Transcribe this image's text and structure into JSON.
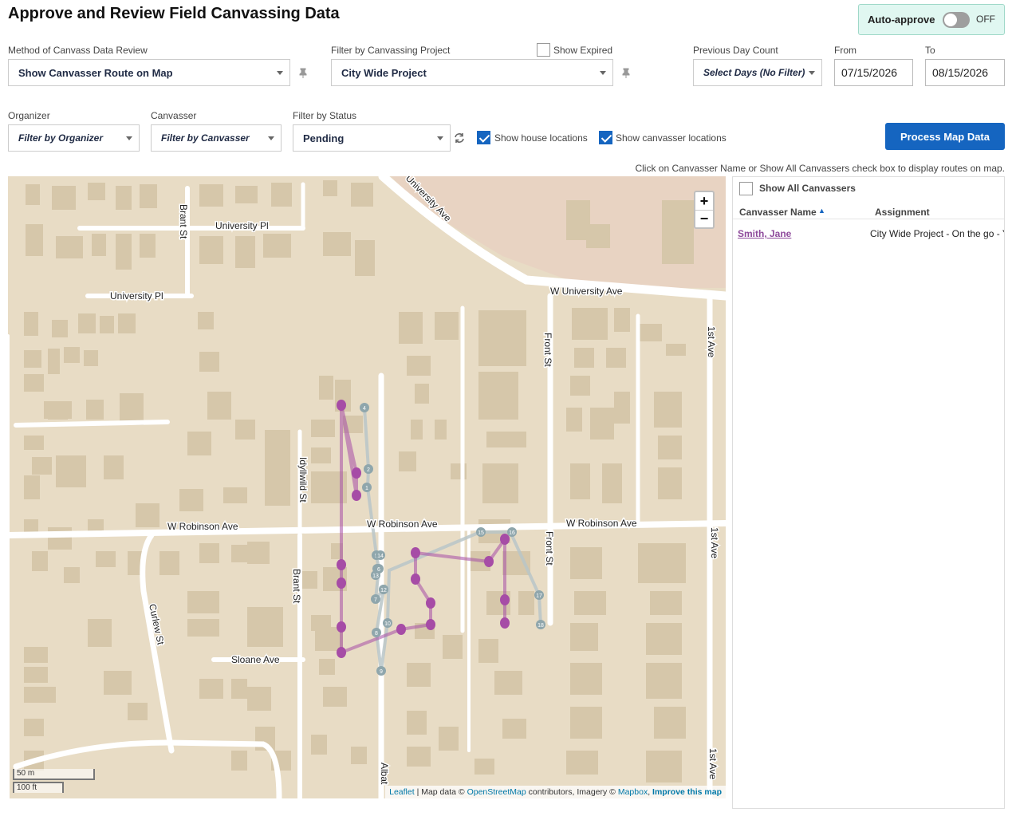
{
  "page_title": "Approve and Review Field Canvassing Data",
  "auto_approve": {
    "label": "Auto-approve",
    "state": "OFF"
  },
  "method": {
    "label": "Method of Canvass Data Review",
    "value": "Show Canvasser Route on Map"
  },
  "project": {
    "label": "Filter by Canvassing Project",
    "value": "City Wide Project",
    "show_expired_label": "Show Expired"
  },
  "prev_day": {
    "label": "Previous Day Count",
    "value": "Select Days (No Filter)"
  },
  "date_from": {
    "label": "From",
    "value": "07/15/2026"
  },
  "date_to": {
    "label": "To",
    "value": "08/15/2026"
  },
  "organizer": {
    "label": "Organizer",
    "value": "Filter by Organizer"
  },
  "canvasser": {
    "label": "Canvasser",
    "value": "Filter by Canvasser"
  },
  "status": {
    "label": "Filter by Status",
    "value": "Pending"
  },
  "show_house_locations": "Show house locations",
  "show_canvasser_locations": "Show canvasser locations",
  "process_button": "Process Map Data",
  "hint": "Click on Canvasser Name or Show All Canvassers check box to display routes on map.",
  "map": {
    "streets": {
      "brant_st_n": "Brant St",
      "university_pl_1": "University Pl",
      "university_pl_2": "University Pl",
      "university_ave": "University Ave",
      "w_university_ave": "W University Ave",
      "front_st_n": "Front St",
      "first_ave_n": "1st Ave",
      "idyllwild_st": "Idyllwild St",
      "w_robinson_1": "W Robinson Ave",
      "w_robinson_2": "W Robinson Ave",
      "w_robinson_3": "W Robinson Ave",
      "brant_st_s": "Brant St",
      "front_st_s": "Front St",
      "first_ave_m": "1st Ave",
      "curlew_st": "Curlew St",
      "sloane_ave": "Sloane Ave",
      "first_ave_s": "1st Ave",
      "albat": "Albat"
    },
    "zoom_in": "+",
    "zoom_out": "−",
    "scale_m": "50 m",
    "scale_ft": "100 ft",
    "attribution": {
      "leaflet": "Leaflet",
      "sep1": " | Map data © ",
      "osm": "OpenStreetMap",
      "sep2": " contributors, Imagery © ",
      "mapbox": "Mapbox",
      "sep3": ", ",
      "improve": "Improve this map"
    },
    "house_markers": [
      "1",
      "2",
      "3",
      "4",
      "5",
      "6",
      "7",
      "8",
      "9",
      "10",
      "11",
      "12",
      "13",
      "14",
      "15",
      "16",
      "17",
      "18"
    ],
    "colors": {
      "route": "#a64ca6",
      "house": "#8fa6ac",
      "land": "#e8dcc5",
      "building": "#d6c7aa"
    }
  },
  "panel": {
    "show_all_label": "Show All Canvassers",
    "col_name": "Canvasser Name",
    "col_assignment": "Assignment",
    "rows": [
      {
        "name": "Smith, Jane",
        "assignment": "City Wide Project - On the go - Ye"
      }
    ]
  }
}
